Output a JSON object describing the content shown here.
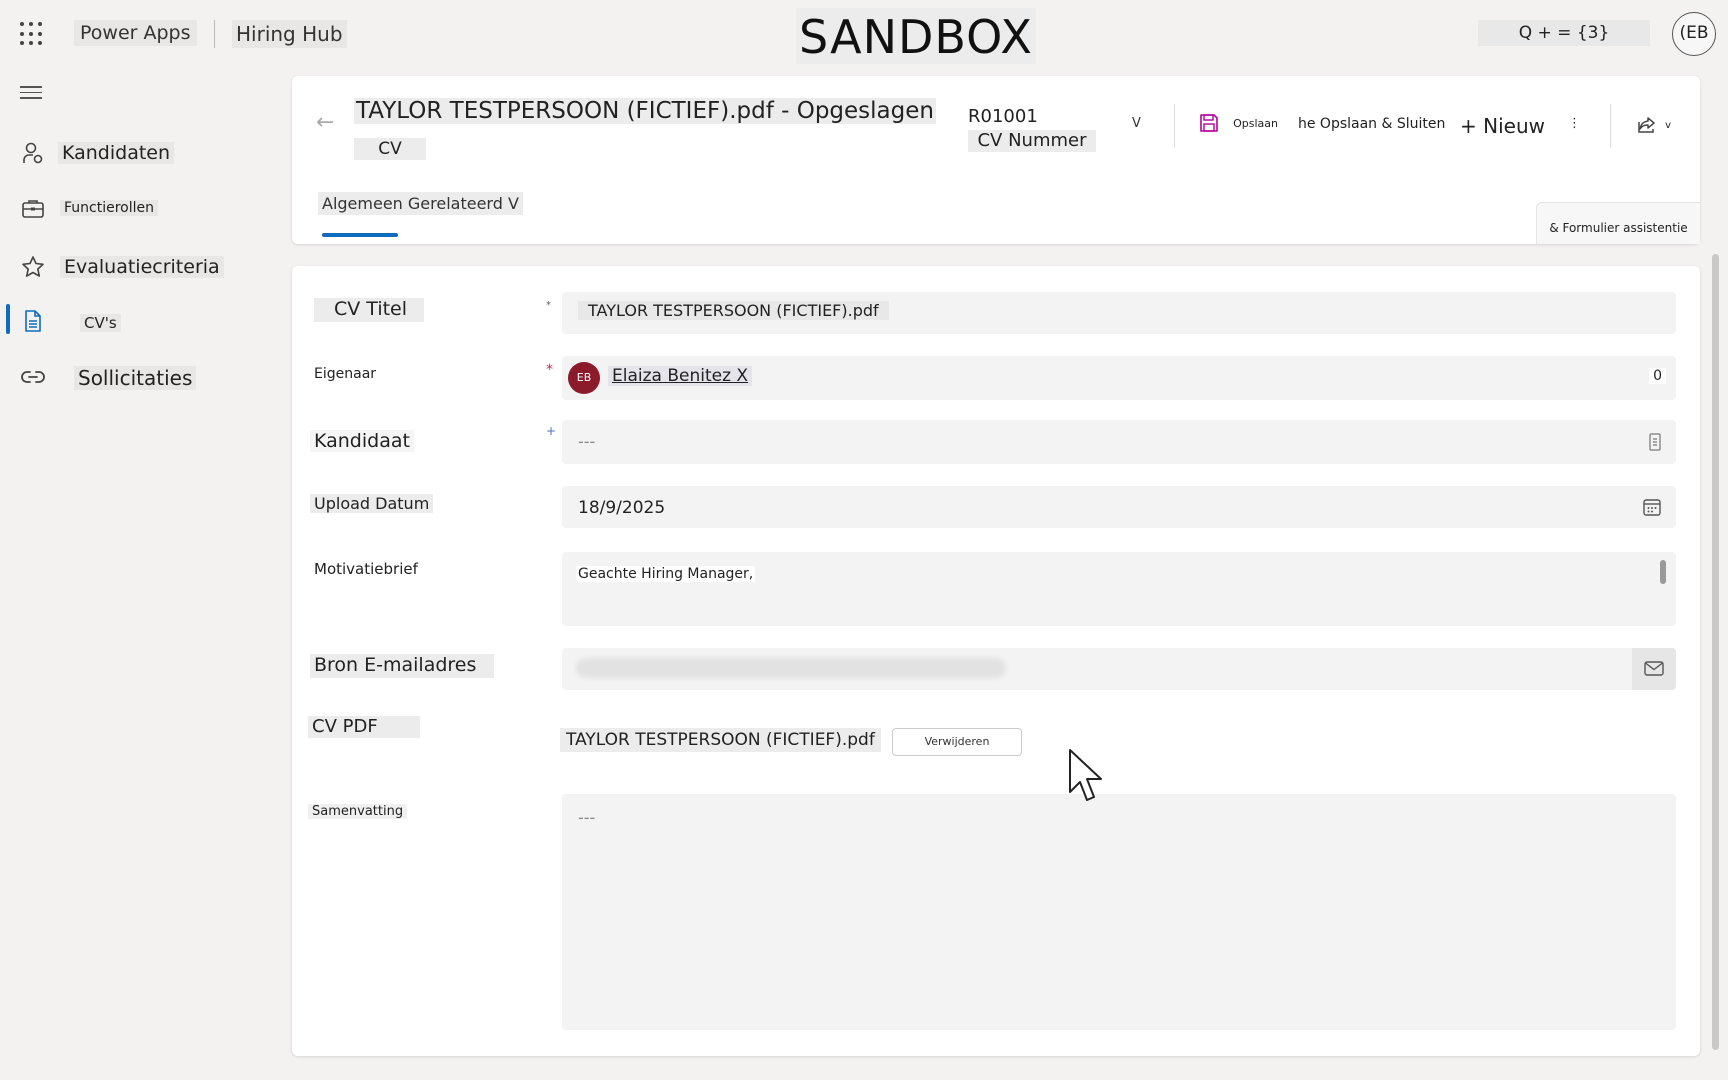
{
  "topbar": {
    "app_name": "Power Apps",
    "hub_name": "Hiring Hub",
    "environment_badge": "SANDBOX",
    "search_text": "Q + = {3}",
    "user_initials": "(EB"
  },
  "sidebar": {
    "items": [
      {
        "label": "Kandidaten",
        "icon": "person-icon"
      },
      {
        "label": "Functierollen",
        "icon": "briefcase-icon"
      },
      {
        "label": "Evaluatiecriteria",
        "icon": "star-icon"
      },
      {
        "label": "CV's",
        "icon": "document-icon",
        "active": true
      },
      {
        "label": "Sollicitaties",
        "icon": "link-icon"
      }
    ]
  },
  "header": {
    "title": "TAYLOR TESTPERSOON (FICTIEF).pdf - Opgeslagen",
    "entity": "CV",
    "record_id": "R01001",
    "record_id_label": "CV Nummer",
    "chevron": "V",
    "commands": {
      "save": "Opslaan",
      "save_close": "he Opslaan & Sluiten",
      "new": "+ Nieuw",
      "more": "⋮",
      "share_chevron": "v"
    },
    "tab_label": "Algemeen Gerelateerd V",
    "assist_label": "& Formulier assistentie"
  },
  "form": {
    "cv_title": {
      "label": "CV Titel",
      "required_mark": "*",
      "value": "TAYLOR TESTPERSOON (FICTIEF).pdf"
    },
    "owner": {
      "label": "Eigenaar",
      "required_mark": "*",
      "initials": "EB",
      "value": "Elaiza Benitez X",
      "count": "0"
    },
    "candidate": {
      "label": "Kandidaat",
      "required_mark": "+",
      "value": "---"
    },
    "upload_date": {
      "label": "Upload Datum",
      "value": "18/9/2025"
    },
    "motivation": {
      "label": "Motivatiebrief",
      "value": "Geachte Hiring Manager,"
    },
    "source_email": {
      "label": "Bron E-mailadres"
    },
    "cv_pdf": {
      "label": "CV PDF",
      "file_name": "TAYLOR TESTPERSOON (FICTIEF).pdf",
      "remove_label": "Verwijderen"
    },
    "summary": {
      "label": "Samenvatting",
      "value": "---"
    }
  },
  "colors": {
    "accent": "#0f6cbd",
    "required": "#c4314b",
    "owner_avatar": "#8b1a2b",
    "save_icon": "#b4009e"
  }
}
